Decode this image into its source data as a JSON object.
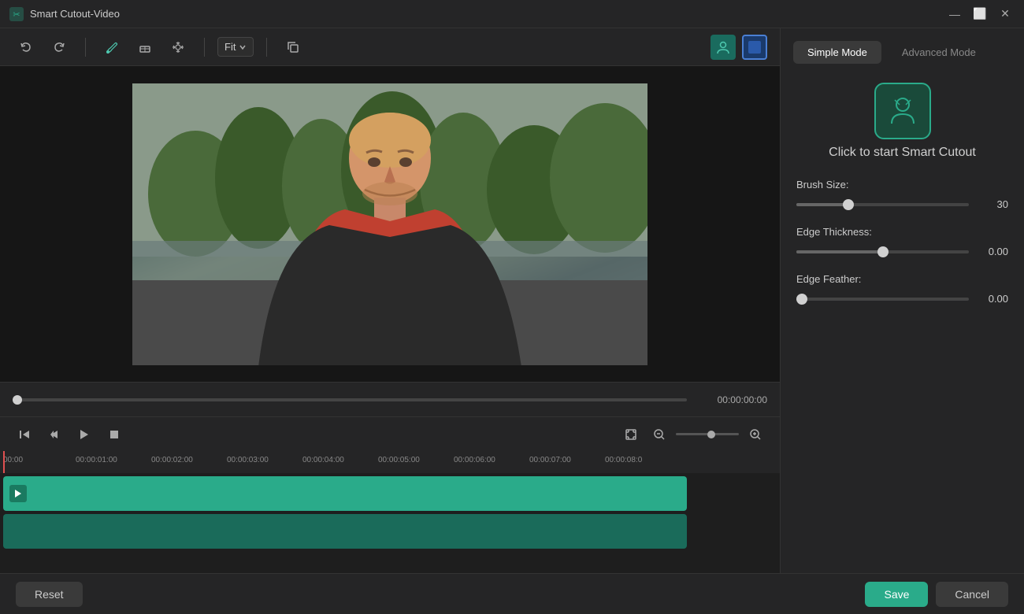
{
  "app": {
    "title": "Smart Cutout-Video"
  },
  "titlebar": {
    "minimize": "—",
    "maximize": "⬜",
    "close": "✕"
  },
  "toolbar": {
    "undo_label": "↩",
    "redo_label": "↪",
    "brush_label": "✏",
    "eraser_label": "◻",
    "pan_label": "✋",
    "fit_label": "Fit",
    "copy_label": "⧉",
    "person_view": "👤",
    "color_view": "■"
  },
  "video": {
    "timecode": "00:00:00:00"
  },
  "controls": {
    "skip_back": "⏮",
    "frame_back": "⏪",
    "play": "▶",
    "stop": "■"
  },
  "timeline": {
    "labels": [
      "00:00",
      "00:00:01:00",
      "00:00:02:00",
      "00:00:03:00",
      "00:00:04:00",
      "00:00:05:00",
      "00:00:06:00",
      "00:00:07:00",
      "00:00:08:0"
    ]
  },
  "right_panel": {
    "simple_mode_label": "Simple Mode",
    "advanced_mode_label": "Advanced Mode",
    "smart_cutout_label": "Click to start Smart Cutout",
    "brush_size_label": "Brush Size:",
    "brush_size_value": "30",
    "edge_thickness_label": "Edge Thickness:",
    "edge_thickness_value": "0.00",
    "edge_feather_label": "Edge Feather:",
    "edge_feather_value": "0.00"
  },
  "bottom": {
    "reset_label": "Reset",
    "save_label": "Save",
    "cancel_label": "Cancel"
  }
}
